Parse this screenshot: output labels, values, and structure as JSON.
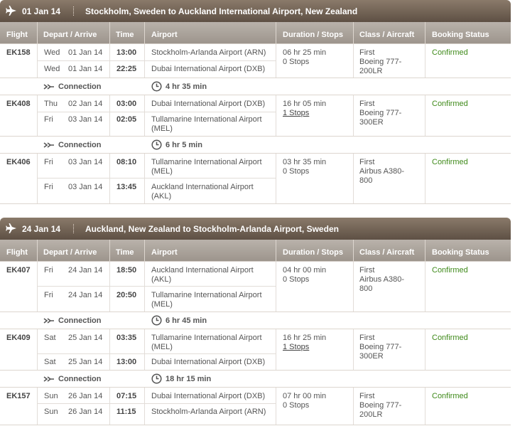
{
  "columns": {
    "flight": "Flight",
    "depart_arrive": "Depart / Arrive",
    "time": "Time",
    "airport": "Airport",
    "duration_stops": "Duration / Stops",
    "class_aircraft": "Class / Aircraft",
    "booking_status": "Booking Status"
  },
  "connection_label": "Connection",
  "icons": {
    "header": "airplane-icon",
    "connection": "double-arrow-icon",
    "duration": "clock-icon"
  },
  "colors": {
    "header_bg": "#6e6054",
    "column_header_bg": "#aaa29b",
    "confirmed": "#3f8a1a"
  },
  "trips": [
    {
      "date": "01 Jan 14",
      "route": "Stockholm, Sweden to Auckland International Airport, New Zealand",
      "flights": [
        {
          "number": "EK158",
          "depart": {
            "day": "Wed",
            "date": "01 Jan 14",
            "time": "13:00",
            "airport": "Stockholm-Arlanda Airport (ARN)"
          },
          "arrive": {
            "day": "Wed",
            "date": "01 Jan 14",
            "time": "22:25",
            "airport": "Dubai International Airport (DXB)"
          },
          "duration": "06 hr 25 min",
          "stops": "0 Stops",
          "class": "First",
          "aircraft": "Boeing 777-200LR",
          "status": "Confirmed"
        },
        {
          "number": "EK408",
          "depart": {
            "day": "Thu",
            "date": "02 Jan 14",
            "time": "03:00",
            "airport": "Dubai International Airport (DXB)"
          },
          "arrive": {
            "day": "Fri",
            "date": "03 Jan 14",
            "time": "02:05",
            "airport": "Tullamarine International Airport (MEL)"
          },
          "duration": "16 hr 05 min",
          "stops": "1 Stops",
          "class": "First",
          "aircraft": "Boeing 777-300ER",
          "status": "Confirmed"
        },
        {
          "number": "EK406",
          "depart": {
            "day": "Fri",
            "date": "03 Jan 14",
            "time": "08:10",
            "airport": "Tullamarine International Airport (MEL)"
          },
          "arrive": {
            "day": "Fri",
            "date": "03 Jan 14",
            "time": "13:45",
            "airport": "Auckland International Airport (AKL)"
          },
          "duration": "03 hr 35 min",
          "stops": "0 Stops",
          "class": "First",
          "aircraft": "Airbus A380-800",
          "status": "Confirmed"
        }
      ],
      "connections": [
        "4 hr 35 min",
        "6 hr 5 min"
      ]
    },
    {
      "date": "24 Jan 14",
      "route": "Auckland, New Zealand to Stockholm-Arlanda Airport, Sweden",
      "flights": [
        {
          "number": "EK407",
          "depart": {
            "day": "Fri",
            "date": "24 Jan 14",
            "time": "18:50",
            "airport": "Auckland International Airport (AKL)"
          },
          "arrive": {
            "day": "Fri",
            "date": "24 Jan 14",
            "time": "20:50",
            "airport": "Tullamarine International Airport (MEL)"
          },
          "duration": "04 hr 00 min",
          "stops": "0 Stops",
          "class": "First",
          "aircraft": "Airbus A380-800",
          "status": "Confirmed"
        },
        {
          "number": "EK409",
          "depart": {
            "day": "Sat",
            "date": "25 Jan 14",
            "time": "03:35",
            "airport": "Tullamarine International Airport (MEL)"
          },
          "arrive": {
            "day": "Sat",
            "date": "25 Jan 14",
            "time": "13:00",
            "airport": "Dubai International Airport (DXB)"
          },
          "duration": "16 hr 25 min",
          "stops": "1 Stops",
          "class": "First",
          "aircraft": "Boeing 777-300ER",
          "status": "Confirmed"
        },
        {
          "number": "EK157",
          "depart": {
            "day": "Sun",
            "date": "26 Jan 14",
            "time": "07:15",
            "airport": "Dubai International Airport (DXB)"
          },
          "arrive": {
            "day": "Sun",
            "date": "26 Jan 14",
            "time": "11:15",
            "airport": "Stockholm-Arlanda Airport (ARN)"
          },
          "duration": "07 hr 00 min",
          "stops": "0 Stops",
          "class": "First",
          "aircraft": "Boeing 777-200LR",
          "status": "Confirmed"
        }
      ],
      "connections": [
        "6 hr 45 min",
        "18 hr 15 min"
      ]
    }
  ]
}
